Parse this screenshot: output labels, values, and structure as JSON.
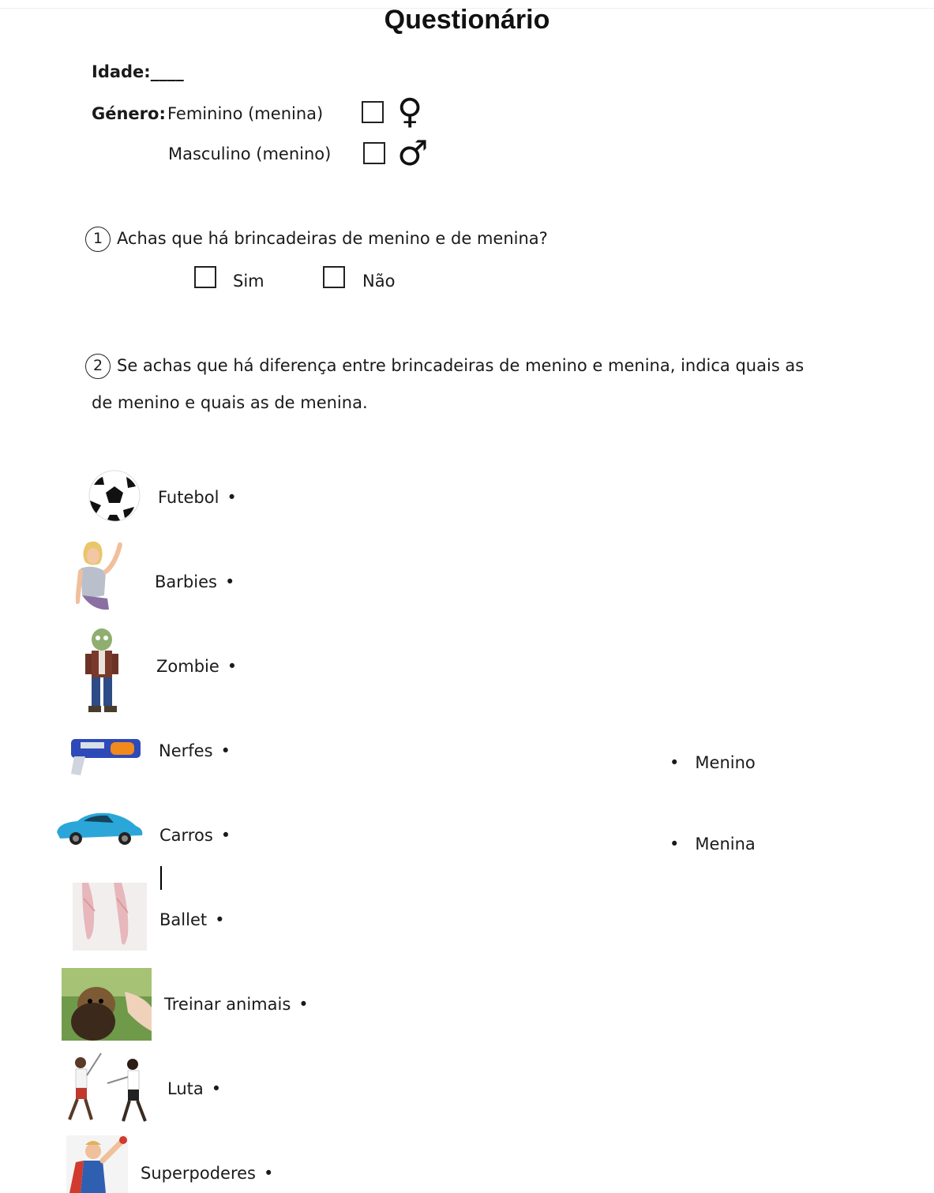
{
  "title": "Questionário",
  "age": {
    "label": "Idade:",
    "blank": "____"
  },
  "gender": {
    "label": "Género:",
    "female": "Feminino (menina)",
    "male": "Masculino  (menino)",
    "female_symbol": "♀",
    "male_symbol": "♂"
  },
  "q1": {
    "number": "1",
    "text": "Achas que há brincadeiras  de  menino e de menina?",
    "options": [
      "Sim",
      "Não"
    ]
  },
  "q2": {
    "number": "2",
    "line1": "Se achas que há diferença entre brincadeiras de menino e menina, indica quais as",
    "line2": "de menino e quais as de menina."
  },
  "activities": [
    {
      "label": "Futebol",
      "icon": "soccer-ball-icon"
    },
    {
      "label": "Barbies",
      "icon": "barbie-doll-icon"
    },
    {
      "label": "Zombie",
      "icon": "zombie-toy-icon"
    },
    {
      "label": "Nerfes",
      "icon": "nerf-gun-icon"
    },
    {
      "label": "Carros",
      "icon": "toy-car-icon"
    },
    {
      "label": "Ballet",
      "icon": "ballet-shoes-icon"
    },
    {
      "label": "Treinar animais",
      "icon": "dog-training-icon"
    },
    {
      "label": "Luta",
      "icon": "fencing-icon"
    },
    {
      "label": "Superpoderes",
      "icon": "superhero-child-icon"
    }
  ],
  "targets": [
    "Menino",
    "Menina"
  ],
  "bullet": "•"
}
